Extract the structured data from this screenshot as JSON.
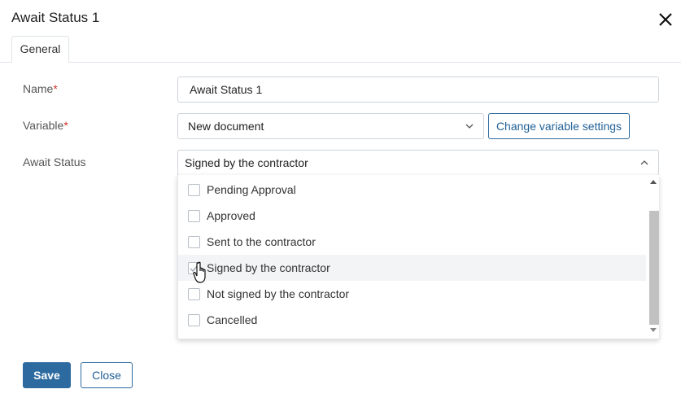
{
  "dialog": {
    "title": "Await Status 1"
  },
  "tabs": [
    {
      "label": "General"
    }
  ],
  "form": {
    "name_label": "Name",
    "name_value": "Await Status 1",
    "variable_label": "Variable",
    "variable_value": "New document",
    "change_variable_label": "Change variable settings",
    "await_status_label": "Await Status",
    "await_status_value": "Signed by the contractor",
    "required_mark": "*"
  },
  "options": [
    {
      "label": "Pending Approval",
      "checked": false
    },
    {
      "label": "Approved",
      "checked": false
    },
    {
      "label": "Sent to the contractor",
      "checked": false
    },
    {
      "label": "Signed by the contractor",
      "checked": true,
      "hovered": true
    },
    {
      "label": "Not signed by the contractor",
      "checked": false
    },
    {
      "label": "Cancelled",
      "checked": false
    }
  ],
  "footer": {
    "save_label": "Save",
    "close_label": "Close"
  },
  "icons": {
    "close": "close-icon",
    "chevron": "chevron-down-icon",
    "cursor": "hand-pointer-icon"
  },
  "colors": {
    "accent": "#2d6a9f",
    "required": "#d0312d"
  }
}
